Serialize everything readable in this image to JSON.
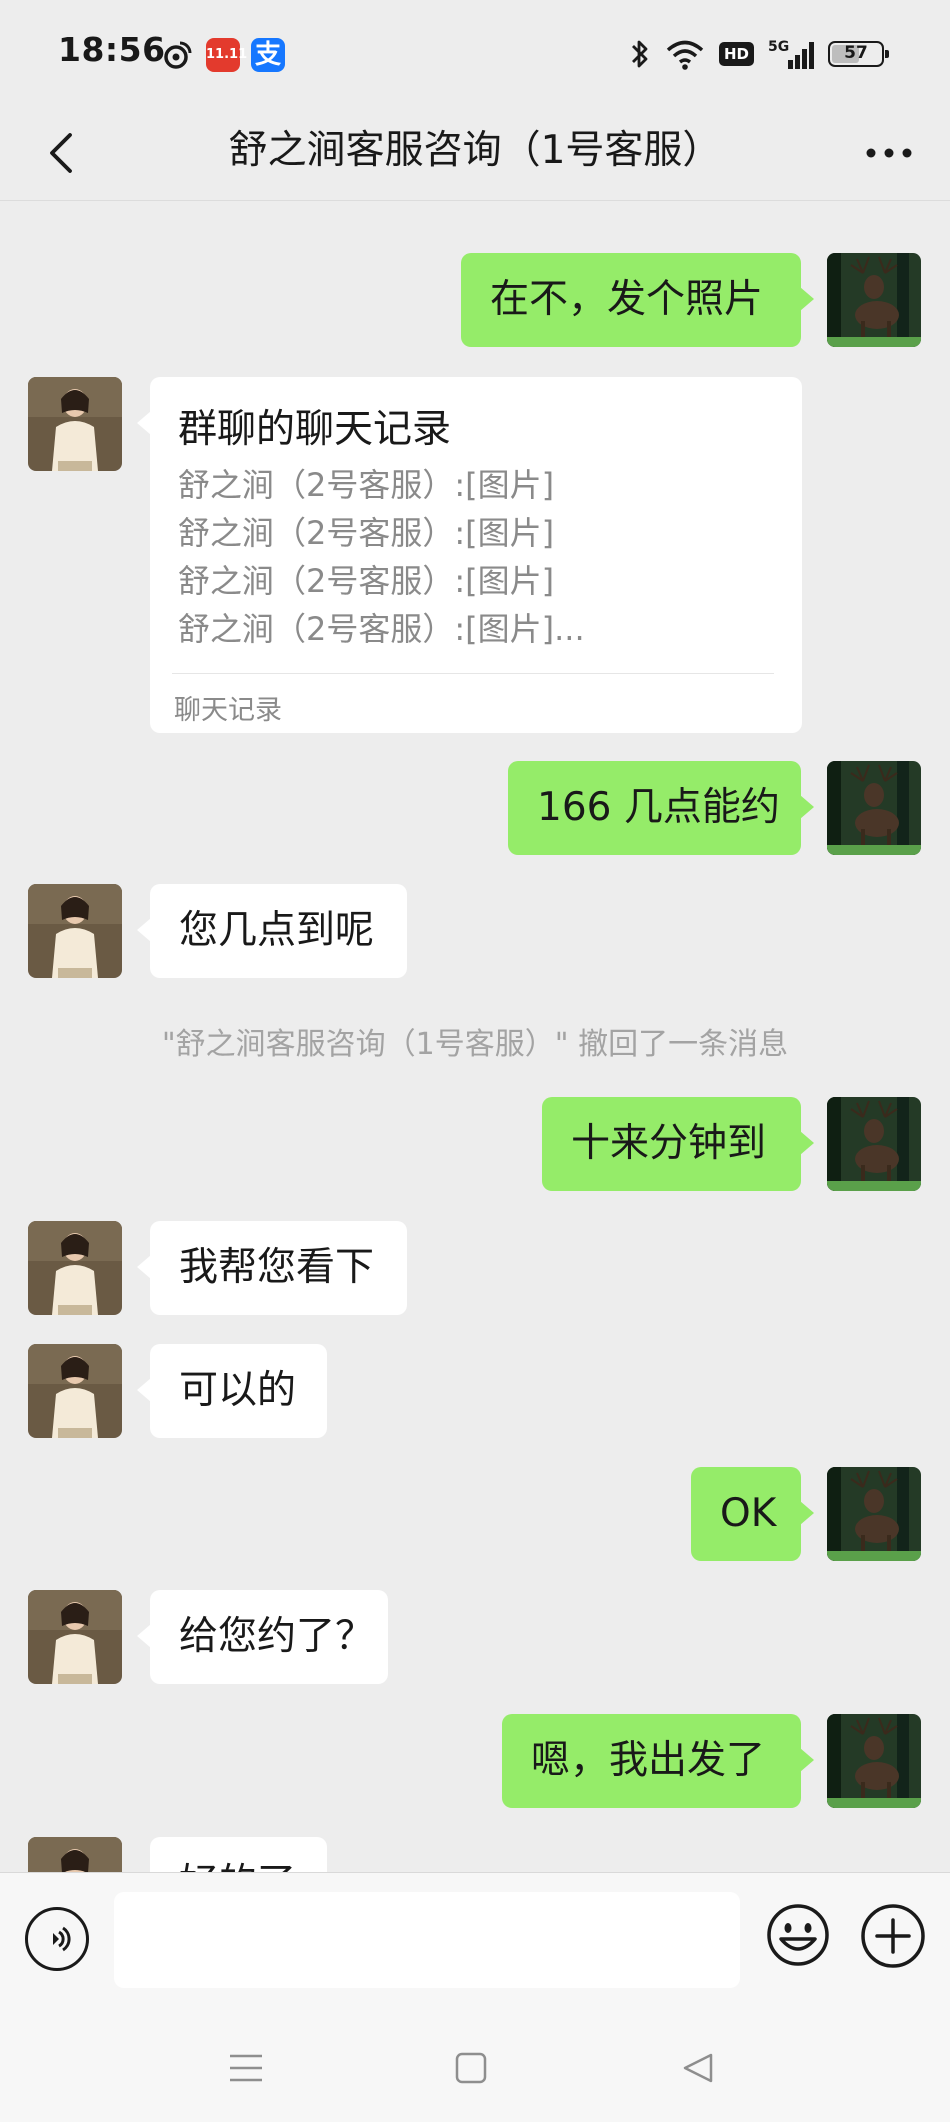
{
  "status_bar": {
    "time": "18:56",
    "apps": [
      "weibo-icon",
      "taobao-1111-icon",
      "alipay-icon"
    ],
    "app_labels": {
      "taobao": "11.11",
      "alipay": "支"
    },
    "network": "5G",
    "hd_label": "HD",
    "battery": "57",
    "battery_level": 0.57
  },
  "header": {
    "title": "舒之涧客服咨询（1号客服）"
  },
  "messages": [
    {
      "side": "out",
      "text": "在不，发个照片"
    },
    {
      "side": "in",
      "type": "chat_record",
      "title": "群聊的聊天记录",
      "lines": [
        "舒之涧（2号客服）:[图片]",
        "舒之涧（2号客服）:[图片]",
        "舒之涧（2号客服）:[图片]",
        "舒之涧（2号客服）:[图片]..."
      ],
      "footer": "聊天记录"
    },
    {
      "side": "out",
      "text": "166 几点能约"
    },
    {
      "side": "in",
      "text": "您几点到呢"
    },
    {
      "type": "system",
      "text": "\"舒之涧客服咨询（1号客服）\" 撤回了一条消息"
    },
    {
      "side": "out",
      "text": "十来分钟到"
    },
    {
      "side": "in",
      "text": "我帮您看下"
    },
    {
      "side": "in",
      "text": "可以的"
    },
    {
      "side": "out",
      "text": "OK"
    },
    {
      "side": "in",
      "text": "给您约了？"
    },
    {
      "side": "out",
      "text": "嗯，我出发了"
    },
    {
      "side": "in",
      "text": "好的了"
    }
  ],
  "input": {
    "value": "",
    "placeholder": ""
  },
  "colors": {
    "background": "#ededed",
    "outgoing_bubble": "#95ec69",
    "incoming_bubble": "#ffffff",
    "system_text": "#a3a3a3"
  }
}
